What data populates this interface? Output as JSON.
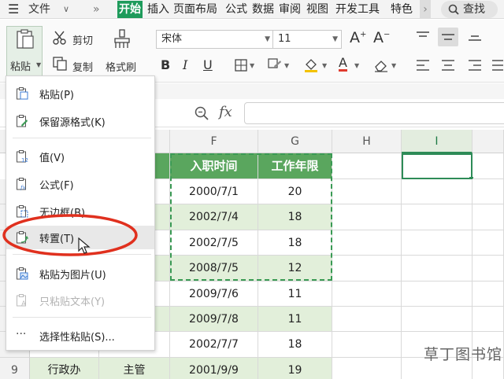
{
  "menubar": {
    "file_label": "文件",
    "tabs": [
      {
        "label": "开始",
        "active": true
      },
      {
        "label": "插入",
        "active": false
      },
      {
        "label": "页面布局",
        "active": false
      },
      {
        "label": "公式",
        "active": false
      },
      {
        "label": "数据",
        "active": false
      },
      {
        "label": "审阅",
        "active": false
      },
      {
        "label": "视图",
        "active": false
      },
      {
        "label": "开发工具",
        "active": false
      },
      {
        "label": "特色",
        "active": false
      }
    ],
    "search_label": "查找",
    "accent_color": "#1e9b5b"
  },
  "ribbon": {
    "paste_label": "粘贴",
    "cut_label": "剪切",
    "copy_label": "复制",
    "format_painter_label": "格式刷",
    "font_name": "宋体",
    "font_size": "11"
  },
  "formula_bar": {
    "fx_label": "fx",
    "value": ""
  },
  "paste_menu": {
    "items": [
      {
        "label": "粘贴(P)",
        "icon": "paste-icon",
        "enabled": true
      },
      {
        "label": "保留源格式(K)",
        "icon": "paste-keep-format-icon",
        "enabled": true
      },
      {
        "label": "值(V)",
        "icon": "paste-values-icon",
        "enabled": true
      },
      {
        "label": "公式(F)",
        "icon": "paste-formula-icon",
        "enabled": true
      },
      {
        "label": "无边框(B)",
        "icon": "paste-no-border-icon",
        "enabled": true
      },
      {
        "label": "转置(T)",
        "icon": "paste-transpose-icon",
        "enabled": true,
        "highlighted": true
      },
      {
        "label": "粘贴为图片(U)",
        "icon": "paste-as-picture-icon",
        "enabled": true
      },
      {
        "label": "只粘贴文本(Y)",
        "icon": "paste-text-only-icon",
        "enabled": false
      },
      {
        "label": "选择性粘贴(S)...",
        "icon": "paste-special-icon",
        "enabled": true
      }
    ],
    "annotation_color": "#e0301e"
  },
  "sheet": {
    "columns": [
      "F",
      "G",
      "H",
      "I"
    ],
    "selected_column": "I",
    "header_row": {
      "e": "",
      "f": "入职时间",
      "g": "工作年限"
    },
    "rows": [
      {
        "num": "",
        "d": "",
        "e": "",
        "f": "2000/7/1",
        "g": "20"
      },
      {
        "num": "",
        "d": "",
        "e": "",
        "f": "2002/7/4",
        "g": "18"
      },
      {
        "num": "",
        "d": "",
        "e": "",
        "f": "2002/7/5",
        "g": "18"
      },
      {
        "num": "",
        "d": "",
        "e": "",
        "f": "2008/7/5",
        "g": "12"
      },
      {
        "num": "",
        "d": "",
        "e": "",
        "f": "2009/7/6",
        "g": "11"
      },
      {
        "num": "",
        "d": "",
        "e": "",
        "f": "2009/7/8",
        "g": "11"
      },
      {
        "num": "",
        "d": "",
        "e": "",
        "f": "2002/7/7",
        "g": "18"
      },
      {
        "num": "9",
        "d": "行政办",
        "e": "主管",
        "f": "2001/9/9",
        "g": "19"
      }
    ],
    "header_fill": "#5aa65e",
    "band_fill": "#e2efda"
  },
  "watermark": {
    "text": "草丁图书馆"
  }
}
